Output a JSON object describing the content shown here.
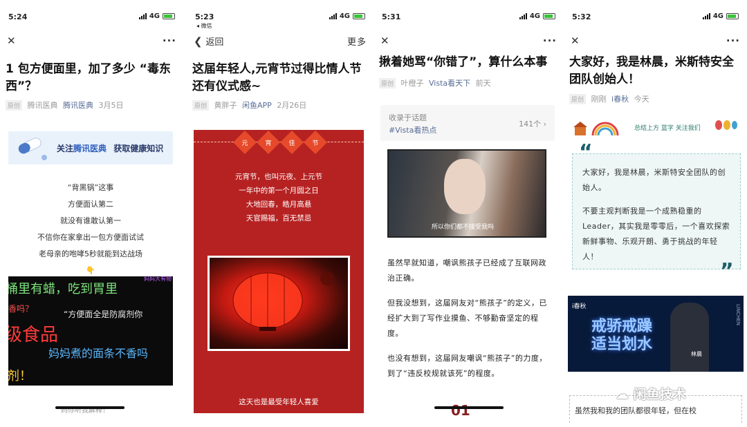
{
  "phone1": {
    "status": {
      "time": "5:24",
      "network": "4G"
    },
    "nav": {
      "close": "✕",
      "more": "···"
    },
    "title": "1 包方便面里，加了多少 “毒东西”？",
    "meta": {
      "tag": "原创",
      "author": "腾讯医典",
      "account": "腾讯医典",
      "date": "3月5日"
    },
    "banner": {
      "prefix": "关注",
      "account": "腾讯医典",
      "suffix": "获取健康知识"
    },
    "poem": [
      "“背黑锅”这事",
      "方便面认第二",
      "就没有谁敢认第一",
      "不信你在家拿出一包方便面试试",
      "老母亲的咆哮5秒就能到达战场"
    ],
    "pointer_emoji": "👇",
    "image_texts": [
      "桶里有蜡，吃到胃里",
      "香吗？",
      "“方便面全是防腐剂你",
      "级食品",
      "妈妈煮的面条不香吗",
      "剂！"
    ],
    "image_corner": "妈妈大有物",
    "bottom_peek": "妈你听我解释！"
  },
  "phone2": {
    "status": {
      "time": "5:23",
      "network": "4G",
      "back_app": "◂ 微信"
    },
    "nav": {
      "back": "返回",
      "more": "更多"
    },
    "title": "这届年轻人,元宵节过得比情人节还有仪式感~",
    "meta": {
      "tag": "原创",
      "author": "黄胖子",
      "account": "闲鱼APP",
      "date": "2月26日"
    },
    "header_chars": [
      "元",
      "宵",
      "佳",
      "节"
    ],
    "poem": [
      "元宵节，也叫元夜、上元节",
      "一年中的第一个月圆之日",
      "大地回春，皓月高悬",
      "天官赐福，百无禁忌"
    ],
    "footer": "这天也是最受年轻人喜爱"
  },
  "phone3": {
    "status": {
      "time": "5:31",
      "network": "4G"
    },
    "nav": {
      "close": "✕",
      "more": "···"
    },
    "title": "揪着她骂“你错了”，算什么本事",
    "meta": {
      "tag": "原创",
      "author": "叶橙子",
      "account": "Vista看天下",
      "date": "前天"
    },
    "topic": {
      "label": "收录于话题",
      "name": "#Vista看热点",
      "count": "141个"
    },
    "video_subtitle": "所以你们都不接受我吗",
    "paragraphs": [
      "虽然早就知道，嘲讽熊孩子已经成了互联网政治正确。",
      "但我没想到，这届网友对“熊孩子”的定义，已经扩大到了写作业摸鱼、不够勤奋坚定的程度。",
      "也没有想到，这届网友嘲讽“熊孩子”的力度，到了“违反校规就该死”的程度。"
    ],
    "bottom_peek": "01"
  },
  "phone4": {
    "status": {
      "time": "5:32",
      "network": "4G"
    },
    "nav": {
      "close": "✕",
      "more": "···"
    },
    "title": "大家好，我是林晨，米斯特安全团队创始人！",
    "meta": {
      "tag": "原创",
      "author": "刚刚",
      "account": "i春秋",
      "date": "今天"
    },
    "deco_text": "总结上方 蓝字 关注我们",
    "quote": [
      "大家好，我是林晨，米斯特安全团队的创始人。",
      "不要主观判断我是一个成熟稳重的Leader，其实我是零零后，一个喜欢探索新鲜事物、乐观开朗、勇于挑战的年轻人！"
    ],
    "banner": {
      "brand": "i春秋",
      "headline1": "戒骄戒躁",
      "headline2": "适当划水",
      "person": "林晨",
      "vertical": "LINCHEN"
    },
    "bottom_text": "虽然我和我的团队都很年轻，但在校"
  },
  "watermark": "闲鱼技术"
}
